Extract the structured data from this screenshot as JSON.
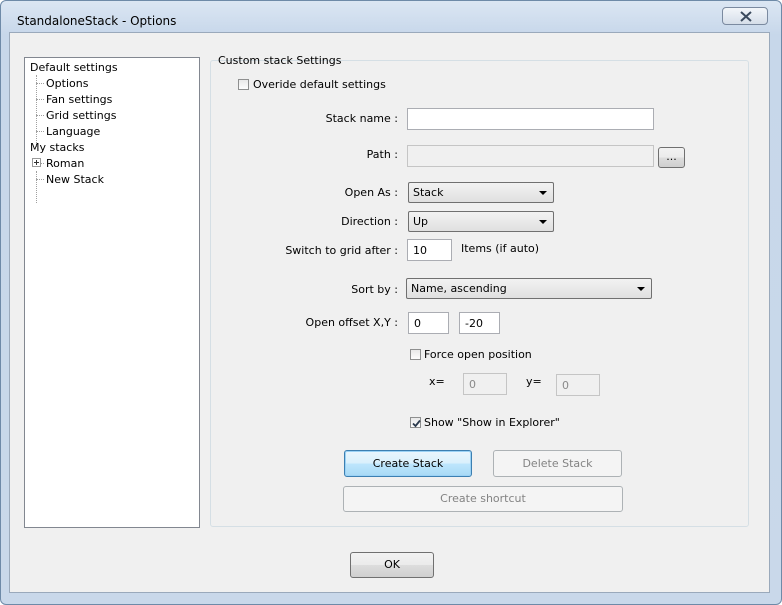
{
  "window": {
    "title": "StandaloneStack - Options"
  },
  "tree": {
    "items": [
      {
        "label": "Default settings"
      },
      {
        "label": "Options"
      },
      {
        "label": "Fan settings"
      },
      {
        "label": "Grid settings"
      },
      {
        "label": "Language"
      },
      {
        "label": "My stacks"
      },
      {
        "label": "Roman"
      },
      {
        "label": "New Stack"
      }
    ]
  },
  "custom": {
    "group_title": "Custom stack Settings",
    "override_label": "Overide default  settings",
    "override_checked": false,
    "stack_name_label": "Stack name :",
    "stack_name_value": "",
    "path_label": "Path :",
    "path_value": "",
    "browse_label": "...",
    "open_as_label": "Open As :",
    "open_as_value": "Stack",
    "direction_label": "Direction :",
    "direction_value": "Up",
    "switch_grid_label": "Switch to grid after :",
    "switch_grid_value": "10",
    "items_suffix": "Items (if auto)",
    "sort_by_label": "Sort by :",
    "sort_by_value": "Name, ascending",
    "offset_label": "Open offset X,Y :",
    "offset_x": "0",
    "offset_y": "-20",
    "force_open_label": "Force open position",
    "force_open_checked": false,
    "x_label": "x=",
    "x_value": "0",
    "y_label": "y=",
    "y_value": "0",
    "show_explorer_label": "Show \"Show in Explorer\"",
    "show_explorer_checked": true,
    "create_stack_label": "Create Stack",
    "delete_stack_label": "Delete Stack",
    "create_shortcut_label": "Create shortcut"
  },
  "footer": {
    "ok_label": "OK"
  }
}
